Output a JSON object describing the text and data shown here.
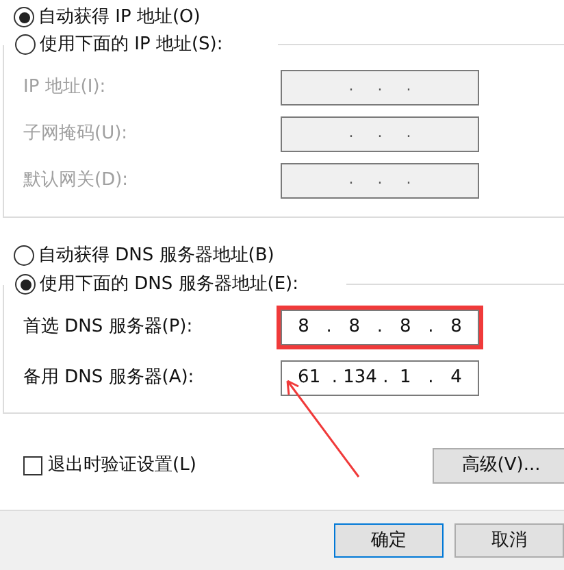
{
  "ip_mode": [
    {
      "label": "自动获得 IP 地址(O)",
      "selected": true
    },
    {
      "label": "使用下面的 IP 地址(S):",
      "selected": false
    }
  ],
  "ip_fields": [
    {
      "label": "IP 地址(I):",
      "value": ".     .     .",
      "disabled": true
    },
    {
      "label": "子网掩码(U):",
      "value": ".     .     .",
      "disabled": true
    },
    {
      "label": "默认网关(D):",
      "value": ".     .     .",
      "disabled": true
    }
  ],
  "dns_mode": [
    {
      "label": "自动获得 DNS 服务器地址(B)",
      "selected": false
    },
    {
      "label": "使用下面的 DNS 服务器地址(E):",
      "selected": true
    }
  ],
  "dns_fields": [
    {
      "label": "首选 DNS 服务器(P):",
      "value": "8   .   8   .   8   .   8",
      "disabled": false,
      "highlighted": true
    },
    {
      "label": "备用 DNS 服务器(A):",
      "value": "61  . 134 .  1   .   4",
      "disabled": false,
      "highlighted": false
    }
  ],
  "validate_on_exit": {
    "label": "退出时验证设置(L)",
    "checked": false
  },
  "advanced_button": "高级(V)...",
  "buttons": [
    "确定",
    "取消"
  ]
}
